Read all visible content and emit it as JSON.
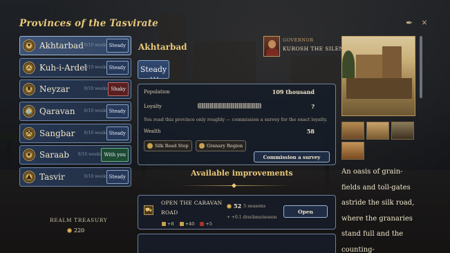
{
  "header": {
    "title": "Provinces of the Tasvirate",
    "feather_icon": "quill-icon",
    "close_label": "×"
  },
  "provinces": [
    {
      "name": "Akhtarbad",
      "weeks": "0/10 weeks",
      "status": "Steady",
      "status_type": "steady",
      "selected": true
    },
    {
      "name": "Kuh-i-Ardel",
      "weeks": "0/10 weeks",
      "status": "Steady",
      "status_type": "steady"
    },
    {
      "name": "Neyzar",
      "weeks": "0/10 weeks",
      "status": "Shaky",
      "status_type": "shaky"
    },
    {
      "name": "Qaravan",
      "weeks": "0/10 weeks",
      "status": "Steady",
      "status_type": "steady"
    },
    {
      "name": "Sangbar",
      "weeks": "0/10 weeks",
      "status": "Steady",
      "status_type": "steady"
    },
    {
      "name": "Saraab",
      "weeks": "0/10 weeks",
      "status": "With you",
      "status_type": "withyou"
    },
    {
      "name": "Tasvir",
      "weeks": "0/10 weeks",
      "status": "Steady",
      "status_type": "steady"
    }
  ],
  "treasury": {
    "label": "REALM TREASURY",
    "value": "220"
  },
  "detail": {
    "name": "Akhtarbad",
    "status": "Steady",
    "governor_label": "GOVERNOR",
    "governor_name": "KUROSH THE SILENT",
    "population_label": "Population",
    "population_value": "109 thousand",
    "loyalty_label": "Loyalty",
    "loyalty_value": "?",
    "loyalty_note": "You read this province only roughly — commission a survey for the exact loyalty.",
    "wealth_label": "Wealth",
    "wealth_value": "58",
    "tags": [
      "Silk Road Stop",
      "Granary Region"
    ],
    "survey_button": "Commission a survey"
  },
  "improvements": {
    "title": "Available improvements",
    "items": [
      {
        "name": "OPEN THE CARAVAN ROAD",
        "cost": "52",
        "seasons": "5 seasons",
        "effect": "+ +0.1 drachms/season",
        "stat_a": "+8",
        "stat_b": "+40",
        "stat_c": "+5",
        "button": "Open"
      }
    ]
  },
  "description": "An oasis of grain-fields and toll-gates astride the silk road, where the granaries stand full and the counting-"
}
